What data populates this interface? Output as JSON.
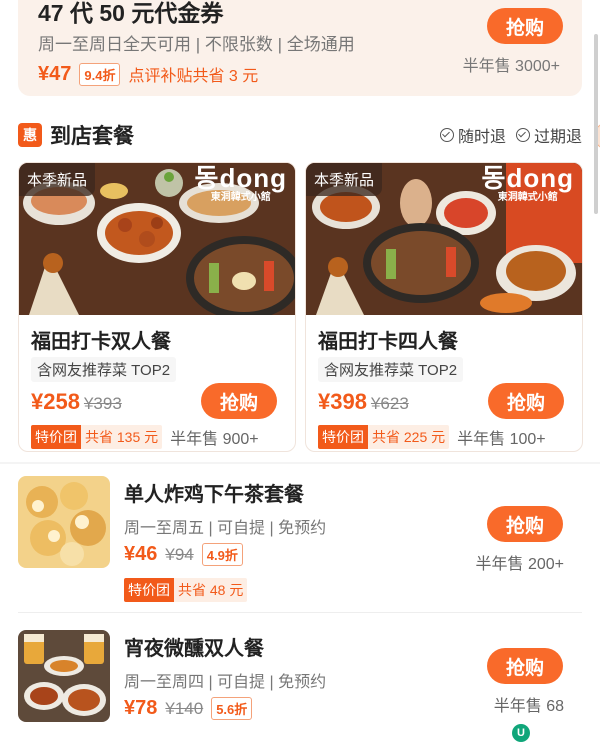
{
  "voucher": {
    "title": "47 代 50 元代金券",
    "rules": "周一至周日全天可用 | 不限张数 | 全场通用",
    "price": "¥47",
    "discount": "9.4折",
    "subsidy": "点评补贴共省 3 元",
    "buy_label": "抢购",
    "sold": "半年售 3000+"
  },
  "section": {
    "badge": "惠",
    "title": "到店套餐",
    "policies": [
      "随时退",
      "过期退"
    ]
  },
  "combos": [
    {
      "season_tag": "本季新品",
      "brand": "동dong",
      "brand_sub": "東洞韓式小館",
      "title": "福田打卡双人餐",
      "recommend": "含网友推荐菜 TOP2",
      "price": "¥258",
      "original": "¥393",
      "buy_label": "抢购",
      "tejia": "特价团",
      "save": "共省 135 元",
      "sold": "半年售 900+"
    },
    {
      "season_tag": "本季新品",
      "brand": "동dong",
      "brand_sub": "東洞韓式小館",
      "title": "福田打卡四人餐",
      "recommend": "含网友推荐菜 TOP2",
      "price": "¥398",
      "original": "¥623",
      "buy_label": "抢购",
      "tejia": "特价团",
      "save": "共省 225 元",
      "sold": "半年售 100+"
    }
  ],
  "deals": [
    {
      "name": "单人炸鸡下午茶套餐",
      "rules": "周一至周五 | 可自提 | 免预约",
      "price": "¥46",
      "original": "¥94",
      "discount": "4.9折",
      "tejia": "特价团",
      "save": "共省 48 元",
      "buy_label": "抢购",
      "sold": "半年售 200+"
    },
    {
      "name": "宵夜微醺双人餐",
      "rules": "周一至周四 | 可自提 | 免预约",
      "price": "¥78",
      "original": "¥140",
      "discount": "5.6折",
      "buy_label": "抢购",
      "sold": "半年售 68"
    }
  ],
  "colors": {
    "accent": "#f25a1a",
    "button": "#f96a2a",
    "voucher_bg": "#fbf1ea"
  },
  "floating_icon": "U"
}
